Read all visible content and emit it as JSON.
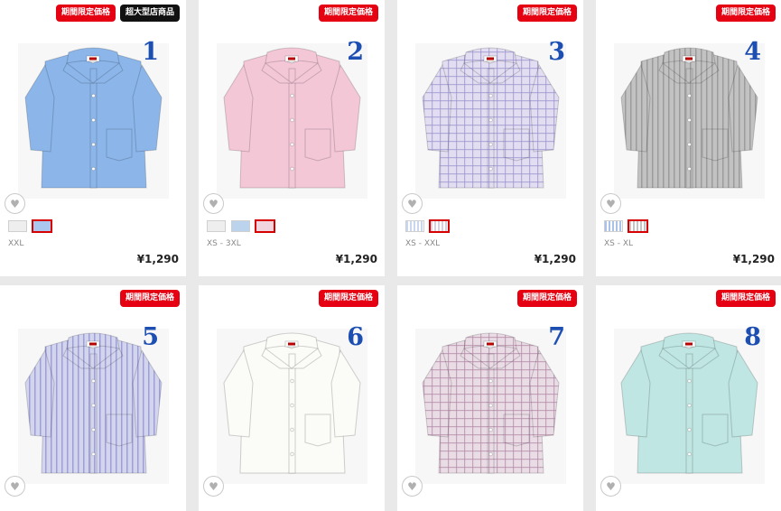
{
  "products": [
    {
      "number": "1",
      "badges": [
        {
          "text": "期間限定価格",
          "style": "red"
        },
        {
          "text": "超大型店商品",
          "style": "black"
        }
      ],
      "shirt": {
        "color": "#8cb6ea",
        "pattern": "solid"
      },
      "swatches": [
        {
          "color": "#eeeeee",
          "selected": false
        },
        {
          "color": "#a9c7ef",
          "selected": true
        }
      ],
      "sizes": "XXL",
      "price": "¥1,290",
      "fav_icon": "heart-plus-icon"
    },
    {
      "number": "2",
      "badges": [
        {
          "text": "期間限定価格",
          "style": "red"
        }
      ],
      "shirt": {
        "color": "#f4c7d7",
        "pattern": "solid"
      },
      "swatches": [
        {
          "color": "#eeeeee",
          "selected": false
        },
        {
          "color": "#bcd3ee",
          "selected": false
        },
        {
          "color": "#f2d6df",
          "selected": true
        }
      ],
      "sizes": "XS - 3XL",
      "price": "¥1,290",
      "fav_icon": "heart-plus-icon"
    },
    {
      "number": "3",
      "badges": [
        {
          "text": "期間限定価格",
          "style": "red"
        }
      ],
      "shirt": {
        "color": "#e2ddf0",
        "pattern": "check",
        "line": "#9b96cf"
      },
      "swatches": [
        {
          "color": "#c9d6ef",
          "selected": false
        },
        {
          "color": "#d9cde3",
          "selected": true
        }
      ],
      "sizes": "XS - XXL",
      "price": "¥1,290",
      "fav_icon": "heart-plus-icon"
    },
    {
      "number": "4",
      "badges": [
        {
          "text": "期間限定価格",
          "style": "red"
        }
      ],
      "shirt": {
        "color": "#c2c2c2",
        "pattern": "stripe",
        "line": "#8e8e8e"
      },
      "swatches": [
        {
          "color": "#a9c2ea",
          "selected": false
        },
        {
          "color": "#c4c4c4",
          "selected": true
        }
      ],
      "sizes": "XS - XL",
      "price": "¥1,290",
      "fav_icon": "heart-plus-icon"
    },
    {
      "number": "5",
      "badges": [
        {
          "text": "期間限定価格",
          "style": "red"
        }
      ],
      "shirt": {
        "color": "#d3d5ef",
        "pattern": "stripe",
        "line": "#8c8fcc"
      },
      "fav_icon": "heart-plus-icon"
    },
    {
      "number": "6",
      "badges": [
        {
          "text": "期間限定価格",
          "style": "red"
        }
      ],
      "shirt": {
        "color": "#fbfbf7",
        "pattern": "solid"
      },
      "fav_icon": "heart-plus-icon"
    },
    {
      "number": "7",
      "badges": [
        {
          "text": "期間限定価格",
          "style": "red"
        }
      ],
      "shirt": {
        "color": "#e9dce5",
        "pattern": "check",
        "line": "#b48aa8"
      },
      "fav_icon": "heart-plus-icon"
    },
    {
      "number": "8",
      "badges": [
        {
          "text": "期間限定価格",
          "style": "red"
        }
      ],
      "shirt": {
        "color": "#bfe6e2",
        "pattern": "solid"
      },
      "fav_icon": "heart-plus-icon"
    }
  ]
}
